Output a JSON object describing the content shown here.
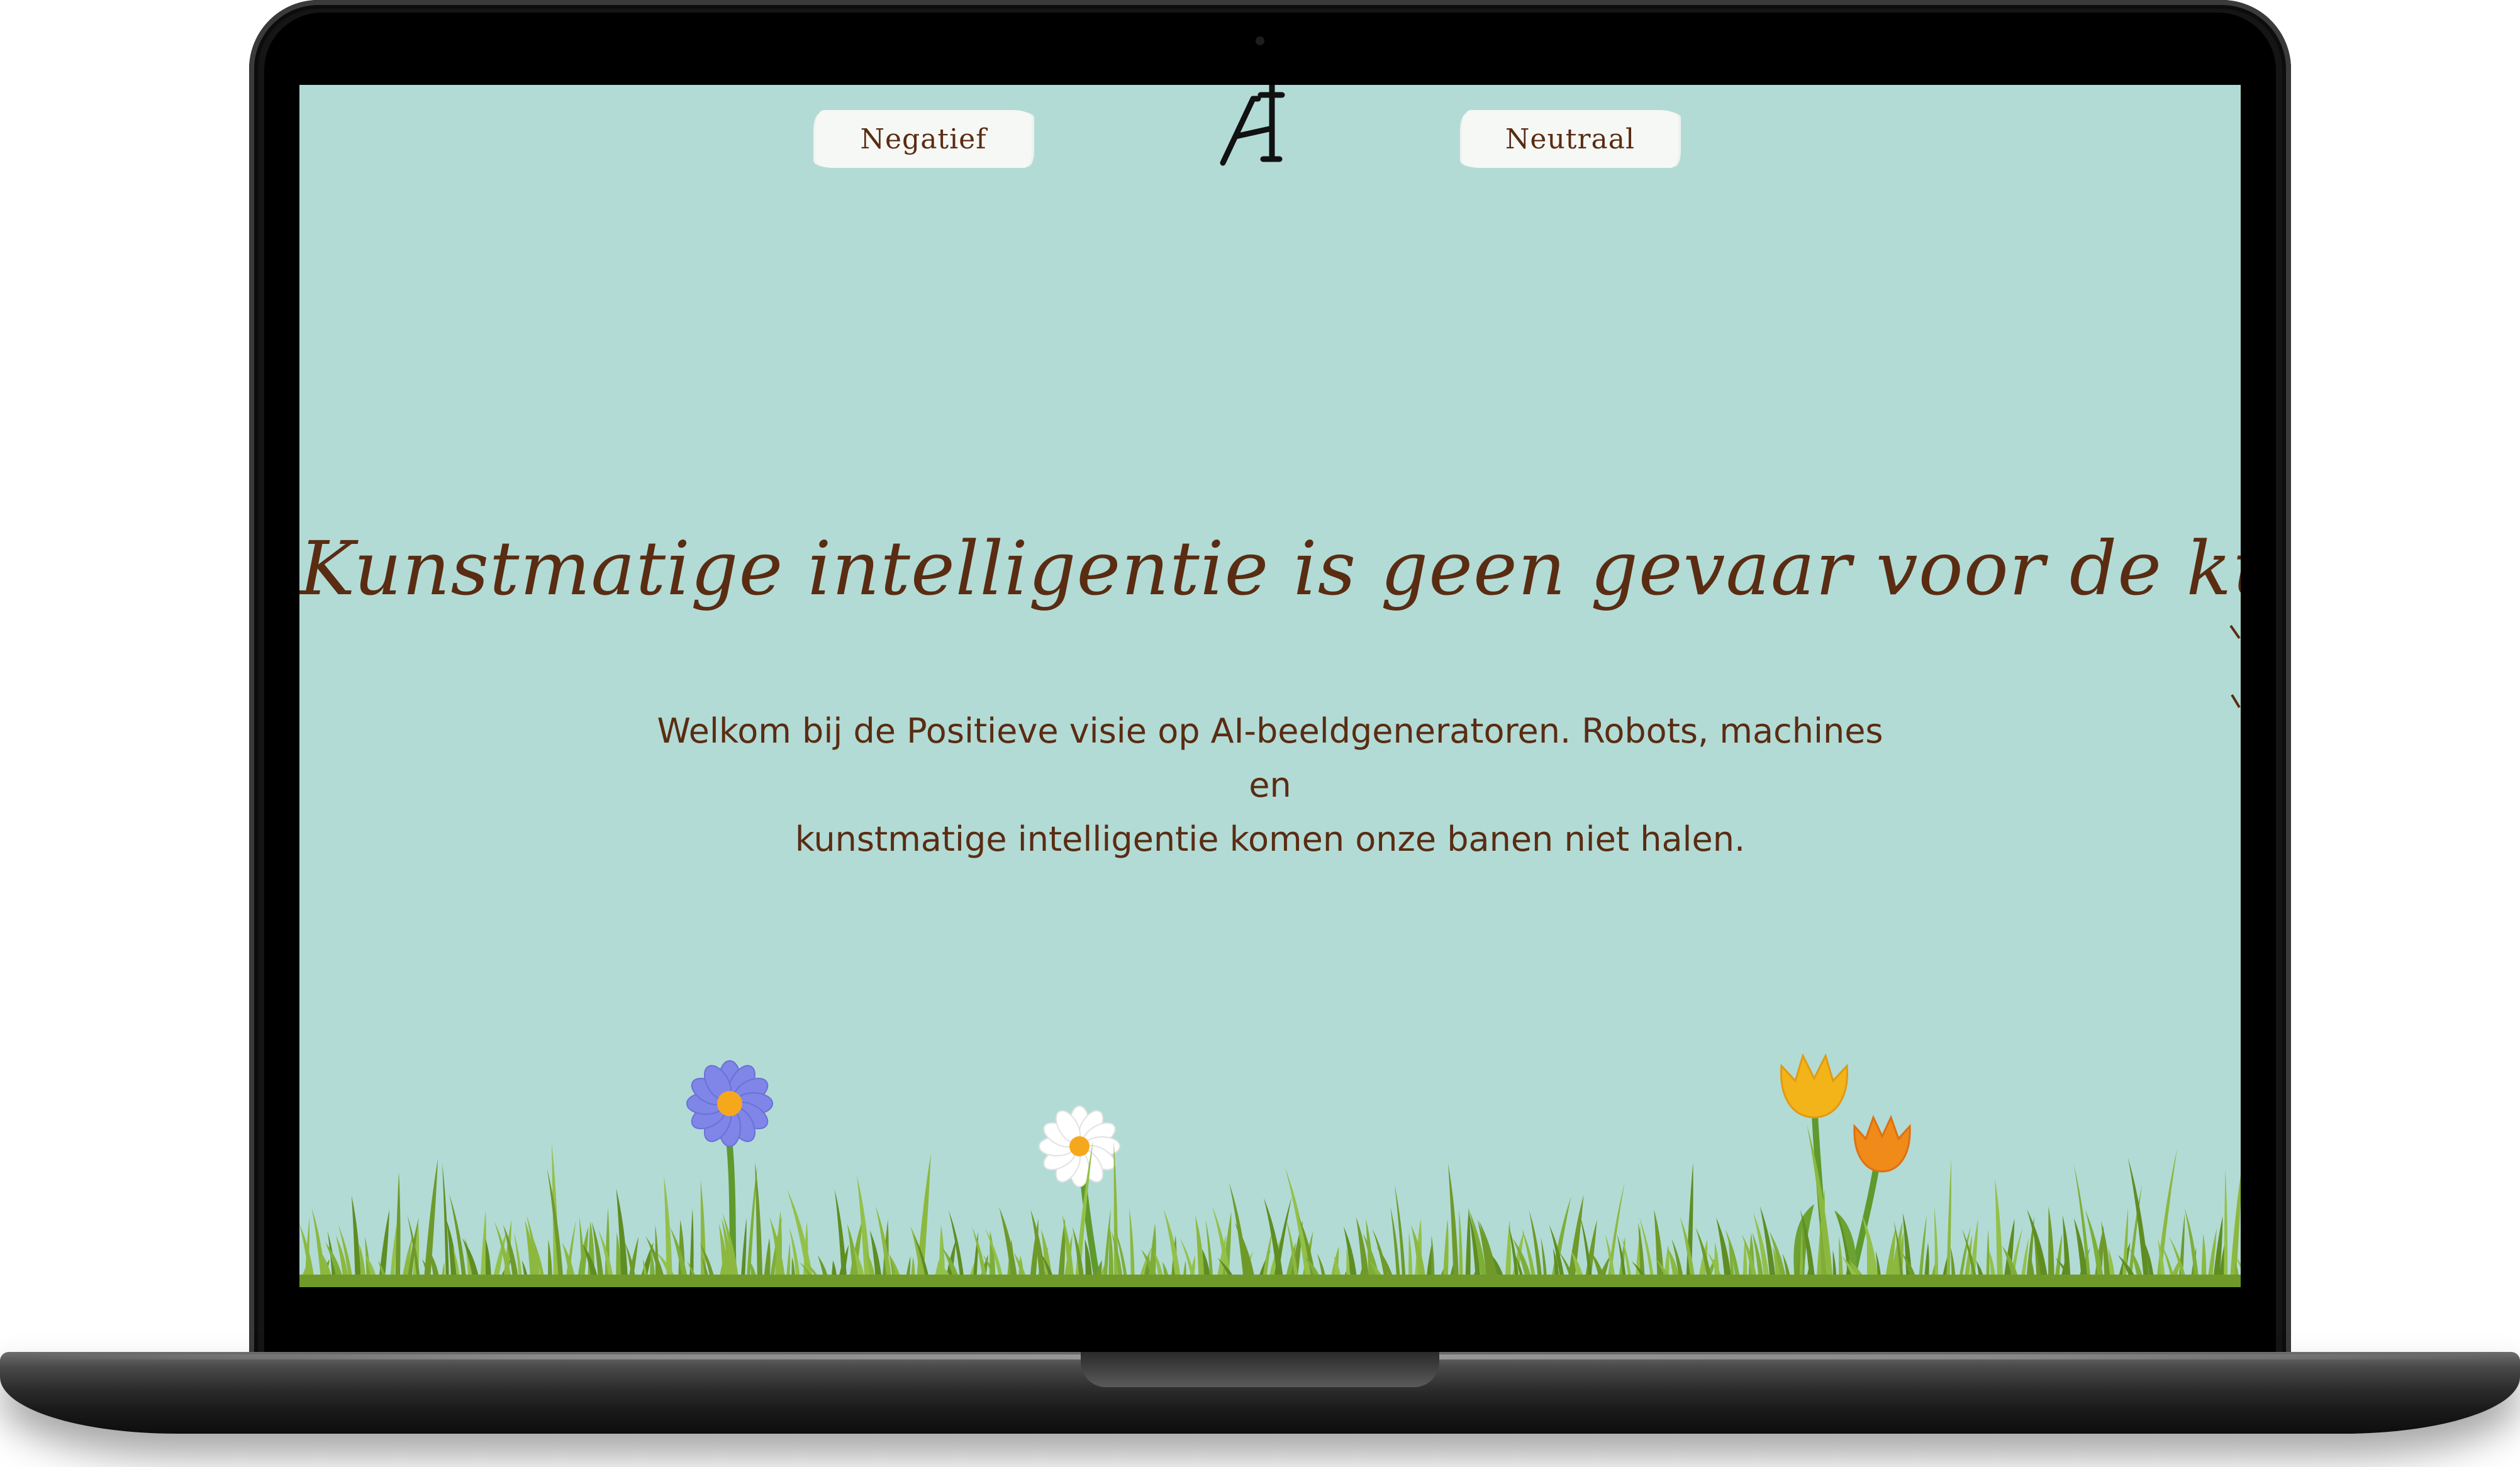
{
  "nav": {
    "left_label": "Negatief",
    "right_label": "Neutraal",
    "logo_text": "AI"
  },
  "hero": {
    "headline": "Kunstmatige intelligentie is geen gevaar voor de kunstenaar integendeel",
    "intro_line1": "Welkom bij de Positieve visie op AI-beeldgeneratoren. Robots, machines en",
    "intro_line2": "kunstmatige intelligentie komen onze banen niet halen."
  },
  "colors": {
    "page_background": "#b2dbd6",
    "text_brown": "#5a2c12",
    "button_fill": "#f6f8f6",
    "grass_green": "#6f9a2a",
    "flower_blue": "#7f86e8",
    "flower_white": "#ffffff",
    "tulip_yellow": "#f2b418",
    "tulip_orange": "#f08a18"
  },
  "icons": [
    "logo-mark",
    "blue-flower-icon",
    "daisy-icon",
    "yellow-tulip-icon",
    "orange-tulip-icon",
    "grass-decoration"
  ]
}
